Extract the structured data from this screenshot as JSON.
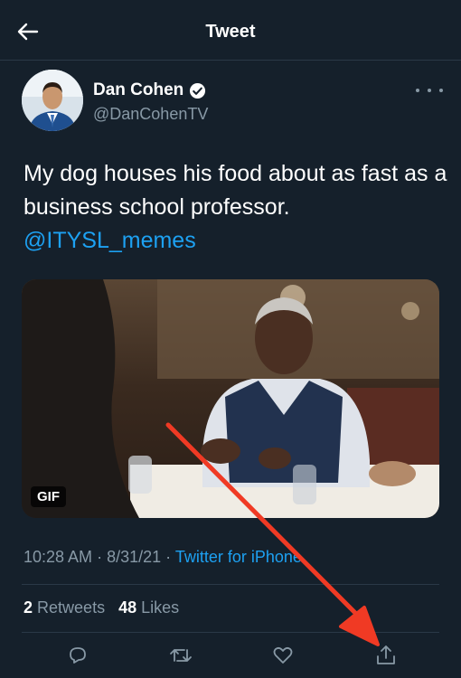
{
  "header": {
    "title": "Tweet",
    "back_icon": "arrow-left-icon"
  },
  "author": {
    "name": "Dan Cohen",
    "handle": "@DanCohenTV",
    "verified": true,
    "verified_icon": "verified-badge-icon",
    "more_icon": "more-horizontal-icon"
  },
  "tweet": {
    "text": "My dog houses his food about as fast as a business school professor.",
    "mention": "@ITYSL_memes"
  },
  "media": {
    "badge": "GIF"
  },
  "meta": {
    "time": "10:28 AM",
    "date": "8/31/21",
    "separator": "·",
    "source": "Twitter for iPhone"
  },
  "stats": {
    "retweets_count": "2",
    "retweets_label": "Retweets",
    "likes_count": "48",
    "likes_label": "Likes"
  },
  "actions": {
    "reply_icon": "reply-icon",
    "retweet_icon": "retweet-icon",
    "like_icon": "heart-icon",
    "share_icon": "share-icon"
  },
  "colors": {
    "background": "#15202b",
    "accent": "#1da1f2",
    "secondary_text": "#8899a6",
    "annotation_arrow": "#f03a24"
  }
}
